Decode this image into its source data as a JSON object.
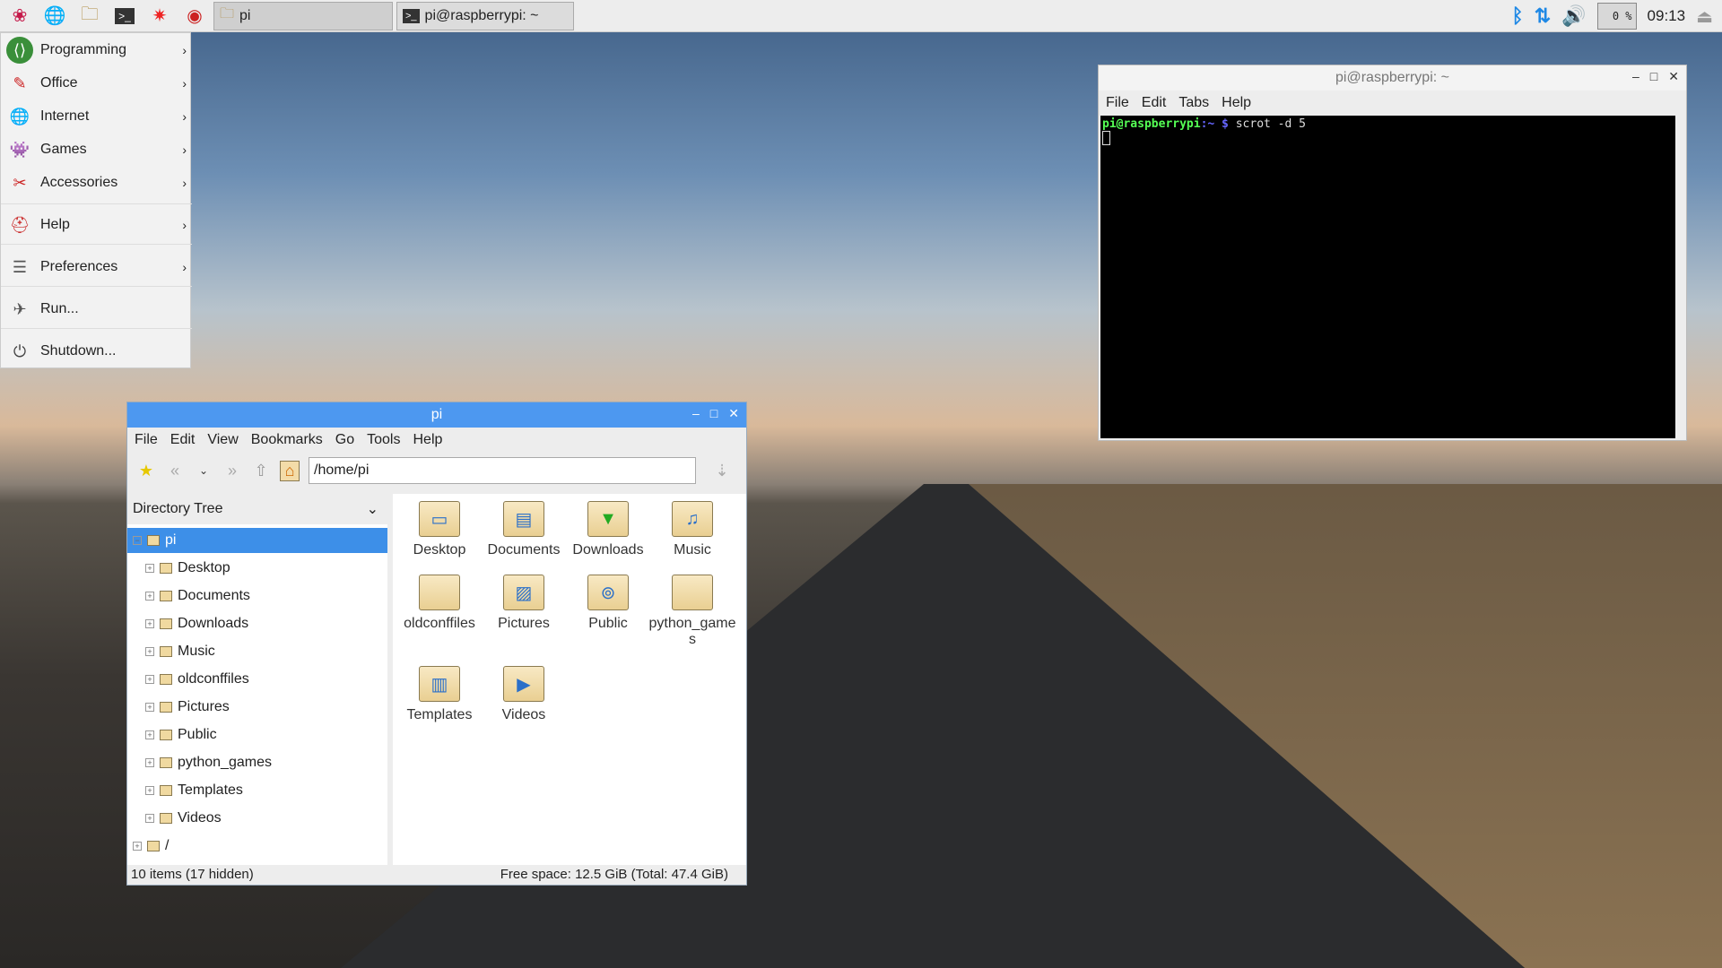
{
  "taskbar": {
    "tasks": [
      {
        "label": "pi"
      },
      {
        "label": "pi@raspberrypi: ~"
      }
    ],
    "cpu": "0 %",
    "clock": "09:13"
  },
  "menu": {
    "items": [
      {
        "label": "Programming"
      },
      {
        "label": "Office"
      },
      {
        "label": "Internet"
      },
      {
        "label": "Games"
      },
      {
        "label": "Accessories"
      },
      {
        "label": "Help"
      },
      {
        "label": "Preferences"
      },
      {
        "label": "Run..."
      },
      {
        "label": "Shutdown..."
      }
    ]
  },
  "terminal": {
    "title": "pi@raspberrypi: ~",
    "menu": [
      "File",
      "Edit",
      "Tabs",
      "Help"
    ],
    "prompt_user": "pi@raspberrypi",
    "prompt_path": ":~",
    "prompt_sym": " $",
    "command": " scrot -d 5"
  },
  "filemanager": {
    "title": "pi",
    "menu": [
      "File",
      "Edit",
      "View",
      "Bookmarks",
      "Go",
      "Tools",
      "Help"
    ],
    "path": "/home/pi",
    "side_title": "Directory Tree",
    "tree": [
      "pi",
      "Desktop",
      "Documents",
      "Downloads",
      "Music",
      "oldconffiles",
      "Pictures",
      "Public",
      "python_games",
      "Templates",
      "Videos",
      "/"
    ],
    "files": [
      "Desktop",
      "Documents",
      "Downloads",
      "Music",
      "oldconffiles",
      "Pictures",
      "Public",
      "python_games",
      "Templates",
      "Videos"
    ],
    "status_left": "10 items (17 hidden)",
    "status_right": "Free space: 12.5 GiB (Total: 47.4 GiB)"
  },
  "colors": {
    "titlebar": "#4d98f0",
    "selection": "#3d8fe8"
  }
}
